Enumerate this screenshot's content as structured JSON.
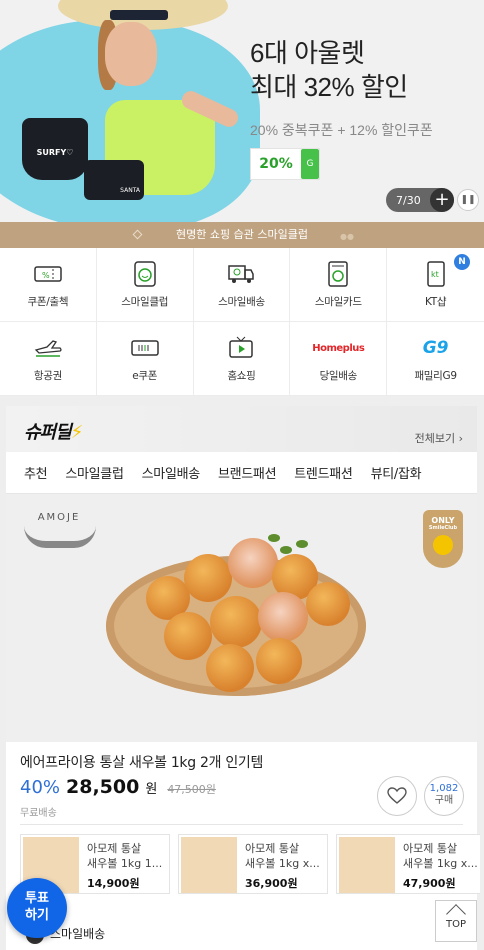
{
  "hero": {
    "headline_line1": "6대 아울렛",
    "headline_line2": "최대 32% 할인",
    "subtitle": "20% 중복쿠폰 + 12% 할인쿠폰",
    "coupon_percent": "20%",
    "coupon_icon": "G",
    "bra_text": "SURFY♡",
    "shorts_text": "SANTA",
    "counter": "7/30",
    "pause_icon": "pause-icon"
  },
  "strip": {
    "text": "현명한 쇼핑 습관 스마일클럽"
  },
  "services": [
    {
      "label": "쿠폰/출첵",
      "icon": "coupon-icon"
    },
    {
      "label": "스마일클럽",
      "icon": "smile-club-icon"
    },
    {
      "label": "스마일배송",
      "icon": "delivery-truck-icon"
    },
    {
      "label": "스마일카드",
      "icon": "card-icon"
    },
    {
      "label": "KT샵",
      "icon": "kt-phone-icon",
      "badge": "N"
    },
    {
      "label": "항공권",
      "icon": "airplane-icon"
    },
    {
      "label": "e쿠폰",
      "icon": "ecoupon-icon"
    },
    {
      "label": "홈쇼핑",
      "icon": "tv-play-icon"
    },
    {
      "label": "당일배송",
      "icon": "homeplus-icon",
      "brand_text": "Homeplus"
    },
    {
      "label": "패밀리G9",
      "icon": "g9-icon",
      "brand_text": "G9"
    }
  ],
  "deal": {
    "logo": "슈퍼딜",
    "view_all": "전체보기 ›",
    "tabs": [
      "추천",
      "스마일클럽",
      "스마일배송",
      "브랜드패션",
      "트렌드패션",
      "뷰티/잡화"
    ],
    "brand": "AMOJE",
    "only_badge": "ONLY",
    "only_sub": "SmileClub",
    "product_title": "에어프라이용 통살 새우볼 1kg 2개 인기템",
    "discount": "40%",
    "price": "28,500",
    "won": "원",
    "original_price": "47,500원",
    "shipping": "무료배송",
    "buy_count": "1,082",
    "buy_label": "구매",
    "minis": [
      {
        "title_line1": "아모제 통살",
        "title_line2": "새우볼 1kg 1...",
        "price": "14,900원"
      },
      {
        "title_line1": "아모제 통살",
        "title_line2": "새우볼 1kg x...",
        "price": "36,900원"
      },
      {
        "title_line1": "아모제 통살",
        "title_line2": "새우볼 1kg x...",
        "price": "47,900원"
      }
    ]
  },
  "bottom": {
    "smile_shipping": "스마일배송",
    "vote_line1": "투표",
    "vote_line2": "하기",
    "top_label": "TOP"
  },
  "colors": {
    "accent_blue": "#2e6fd6",
    "strip_gold": "#bfa27f",
    "coupon_green": "#48c14b",
    "vote_blue": "#1166e8"
  }
}
